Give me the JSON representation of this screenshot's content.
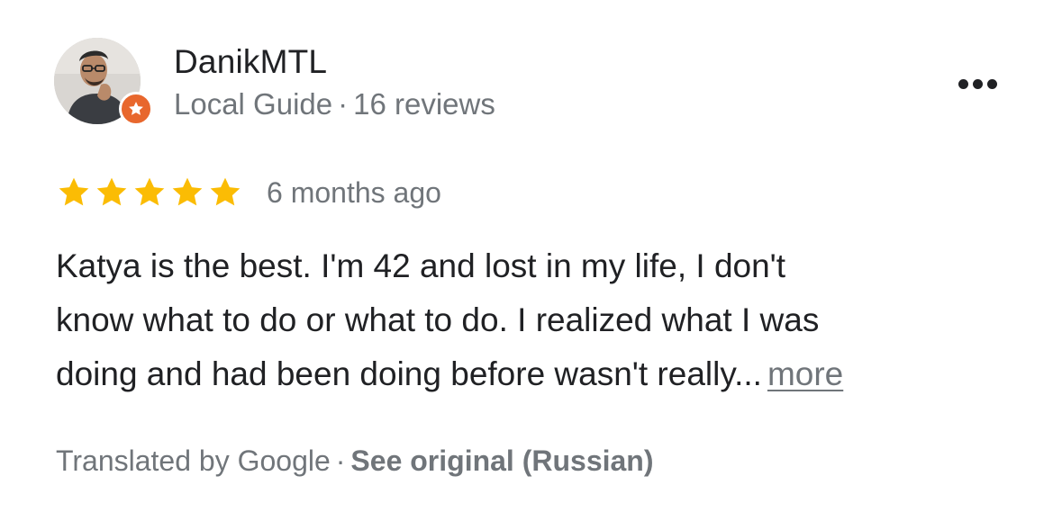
{
  "author": {
    "name": "DanikMTL",
    "badge": "Local Guide",
    "separator": "·",
    "review_count": "16 reviews",
    "badge_color": "#e8672d"
  },
  "menu": {
    "icon": "more-horizontal-icon"
  },
  "review": {
    "rating": 5,
    "rating_max": 5,
    "star_color": "#fbbc04",
    "date": "6 months ago",
    "text_lines": [
      "Katya is the best. I'm 42 and lost in my life, I don't",
      "know what to do or what to do. I realized what I was",
      "doing and had been doing before wasn't really..."
    ],
    "more_label": "more"
  },
  "translation": {
    "note": "Translated by Google",
    "separator": "·",
    "see_original_label": "See original (Russian)"
  }
}
